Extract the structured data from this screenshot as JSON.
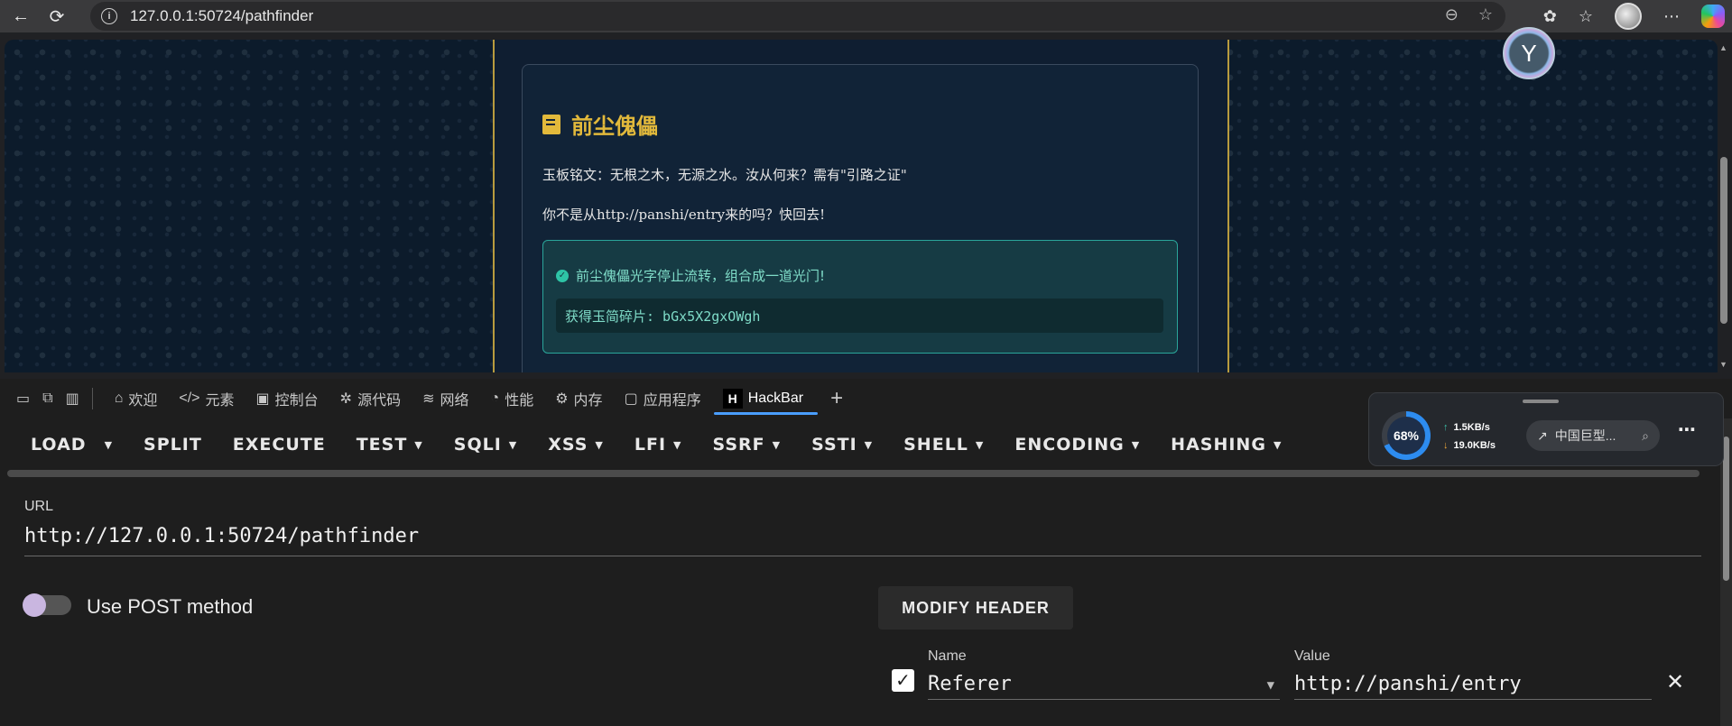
{
  "browser": {
    "url": "127.0.0.1:50724/pathfinder",
    "icons": [
      "back-icon",
      "reload-icon",
      "info-icon",
      "zoom-icon",
      "star-icon",
      "extensions-icon",
      "favorites-icon",
      "profile-avatar",
      "more-icon",
      "copilot-icon"
    ]
  },
  "page": {
    "heading": "前尘傀儡",
    "line1": "玉板铭文：无根之木，无源之水。汝从何来？需有\"引路之证\"",
    "line2": "你不是从http://panshi/entry来的吗？快回去!",
    "success_msg": "前尘傀儡光字停止流转，组合成一道光门!",
    "fragment": "获得玉简碎片: bGx5X2gxOWgh",
    "accent": "#e2b93b"
  },
  "devtools": {
    "tabs": [
      {
        "label": "欢迎",
        "icon": "home-icon"
      },
      {
        "label": "元素",
        "icon": "code-icon"
      },
      {
        "label": "控制台",
        "icon": "console-icon"
      },
      {
        "label": "源代码",
        "icon": "bug-icon"
      },
      {
        "label": "网络",
        "icon": "wifi-icon"
      },
      {
        "label": "性能",
        "icon": "gauge-icon"
      },
      {
        "label": "内存",
        "icon": "chip-icon"
      },
      {
        "label": "应用程序",
        "icon": "app-icon"
      },
      {
        "label": "HackBar",
        "icon": "hackbar-logo"
      }
    ],
    "active_tab": "HackBar"
  },
  "hackbar": {
    "toolbar": [
      "LOAD",
      "SPLIT",
      "EXECUTE",
      "TEST",
      "SQLI",
      "XSS",
      "LFI",
      "SSRF",
      "SSTI",
      "SHELL",
      "ENCODING",
      "HASHING"
    ],
    "url_label": "URL",
    "url_value": "http://127.0.0.1:50724/pathfinder",
    "post_label": "Use POST method",
    "post_enabled": false,
    "modify_header": "MODIFY HEADER",
    "header": {
      "name_label": "Name",
      "name_value": "Referer",
      "value_label": "Value",
      "value_value": "http://panshi/entry",
      "enabled": true
    }
  },
  "netwidget": {
    "percent": "68%",
    "percent_value": 0.68,
    "up": "1.5KB/s",
    "down": "19.0KB/s",
    "search_text": "中国巨型..."
  }
}
